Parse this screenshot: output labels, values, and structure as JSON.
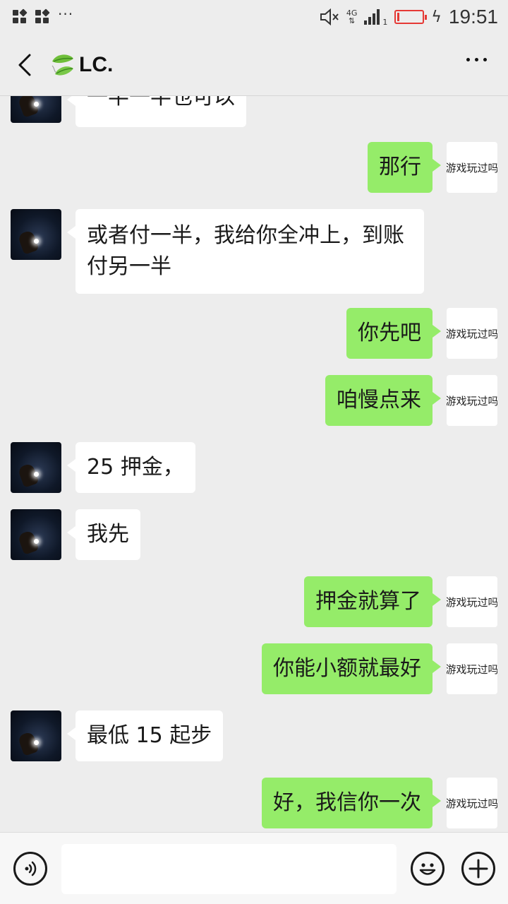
{
  "status_bar": {
    "network": "4G",
    "sim_slot": "1",
    "time": "19:51"
  },
  "nav": {
    "title": "LC."
  },
  "messages": [
    {
      "side": "left",
      "text": "一半一半也可以"
    },
    {
      "side": "right",
      "text": "那行",
      "avatar_text": "游戏玩过吗"
    },
    {
      "side": "left",
      "text": "或者付一半，我给你全冲上，到账付另一半"
    },
    {
      "side": "right",
      "text": "你先吧",
      "avatar_text": "游戏玩过吗"
    },
    {
      "side": "right",
      "text": "咱慢点来",
      "avatar_text": "游戏玩过吗"
    },
    {
      "side": "left",
      "text": "25 押金，"
    },
    {
      "side": "left",
      "text": "我先"
    },
    {
      "side": "right",
      "text": "押金就算了",
      "avatar_text": "游戏玩过吗"
    },
    {
      "side": "right",
      "text": "你能小额就最好",
      "avatar_text": "游戏玩过吗"
    },
    {
      "side": "left",
      "text": "最低 15 起步"
    },
    {
      "side": "right",
      "text": "好，我信你一次",
      "avatar_text": "游戏玩过吗"
    }
  ],
  "input": {
    "value": ""
  },
  "colors": {
    "background": "#ededed",
    "bubble_sent": "#95ec69",
    "bubble_received": "#ffffff",
    "battery_low": "#e53935"
  },
  "icons": {
    "back": "chevron-left-icon",
    "more": "more-dots-icon",
    "voice": "voice-icon",
    "emoji": "emoji-icon",
    "plus": "plus-icon"
  }
}
